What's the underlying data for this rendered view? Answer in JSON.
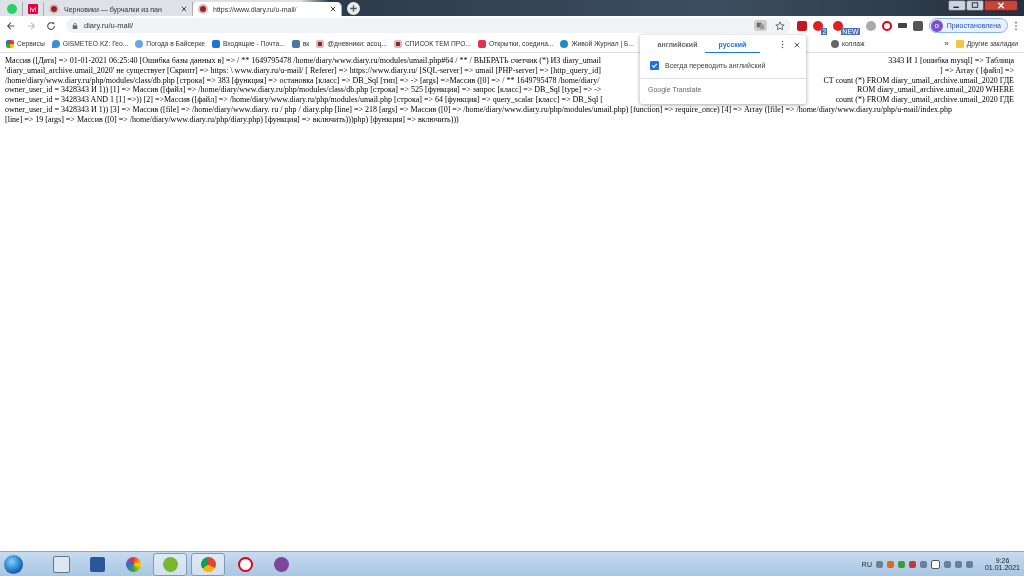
{
  "browser": {
    "tabs": [
      {
        "kind": "pinned",
        "selected": false
      },
      {
        "kind": "pinned",
        "logo_text": "ivi",
        "selected": false
      },
      {
        "kind": "normal",
        "title": "Черновики — бурчалки из пан",
        "selected": false
      },
      {
        "kind": "normal",
        "title": "https://www.diary.ru/u-mail/",
        "selected": true
      }
    ],
    "address": "diary.ru/u-mail/",
    "extensions": [
      {
        "kind": "pdf"
      },
      {
        "kind": "red",
        "badge": "2"
      },
      {
        "kind": "red",
        "badge": "NEW"
      },
      {
        "kind": "grey"
      },
      {
        "kind": "opera"
      },
      {
        "kind": "plug"
      },
      {
        "kind": "puzzle"
      }
    ],
    "profile": {
      "initial": "o",
      "label": "Приостановлена"
    },
    "bookmarks": [
      {
        "label": "Сервисы"
      },
      {
        "label": "GISMETEO.KZ: Гео..."
      },
      {
        "label": "Погода в Байсерке"
      },
      {
        "label": "Входящие - Почта..."
      },
      {
        "label": "вк"
      },
      {
        "label": "@дневники: асоц..."
      },
      {
        "label": "СПИСОК ТЕМ ПРО..."
      },
      {
        "label": "Открытки, соедина..."
      },
      {
        "label": "Живой Журнал | Б..."
      },
      {
        "label": "коллаж"
      }
    ],
    "bookmarks_more": "»",
    "other_bookmarks": "Другие закладки"
  },
  "translate_popup": {
    "tabs": [
      {
        "label": "английский",
        "selected": false
      },
      {
        "label": "русский",
        "selected": true
      }
    ],
    "always_translate": {
      "label": "Всегда переводить английский",
      "checked": true
    },
    "footer": "Google Translate"
  },
  "page": {
    "lines": [
      {
        "left": "Массив ([Дата] => 01-01-2021 06:25:40 [Ошибка базы данных в] => / ** 1649795478 /home/diary/www.diary.ru/modules/umail.php#64 / ** / ВЫБРАТЬ счетчик (*) ИЗ diary_umail",
        "right": "3343 И 1 [ошибка mysql] => Таблица"
      },
      {
        "left": "'diary_umail_archive.umail_2020' не существует [Скрипт] => https: \\ www.diary.ru/u-mail/ [ Referer] => https://www.diary.ru/ [SQL-server] => umail [PHP-server] => [http_query_id]",
        "right": "] => Array ( [файл] =>"
      },
      {
        "left": "/home/diary/www.diary.ru/php/modules/class/db.php [строка] => 383 [функция] => остановка [класс] => DB_Sql [тип] => -> [args] =>Массив ([0] => / ** 1649795478 /home/diary/",
        "right": "CT count (*) FROM diary_umail_archive.umail_2020 ГДЕ"
      },
      {
        "left": "owner_user_id = 3428343 И 1)) [1] => Массив ([файл] => /home/diary/www.diary.ru/php/modules/class/db.php [строка] => 525 [функция] => запрос [класс] => DB_Sql [type] => ->",
        "right": "ROM diary_umail_archive.umail_2020 WHERE"
      },
      {
        "left": "owner_user_id = 3428343 AND 1 [1] =>)) [2] =>Массив ([файл] => /home/diary/www.diary.ru/php/modules/umail.php [строка] => 64 [функция] => query_scalar [класс] => DB_Sql [",
        "right": "count (*) FROM diary_umail_archive.umail_2020 ГДЕ"
      },
      {
        "left": "owner_user_id = 3428343 И 1)) [3] => Массив ([file] => /home/diary/www.diary. ru / php / diary.php [line] => 218 [args] => Массив ([0] => /home/diary/www.diary.ru/php/modules/umail.php) [function] => require_once) [4] => Array ([file] => /home/diary/www.diary.ru/php/u-mail/index.php"
      },
      {
        "left": "[line] => 19 [args] => Массив ([0] => /home/diary/www.diary.ru/php/diary.php) [функция] => включить)))php) [функция] => включить)))"
      }
    ]
  },
  "taskbar": {
    "apps": [
      {
        "open": false
      },
      {
        "open": false
      },
      {
        "open": false
      },
      {
        "open": true
      },
      {
        "open": true
      },
      {
        "open": false
      },
      {
        "open": false
      }
    ],
    "tray": {
      "language": "RU",
      "time": "9:26",
      "date": "01.01.2021"
    }
  }
}
